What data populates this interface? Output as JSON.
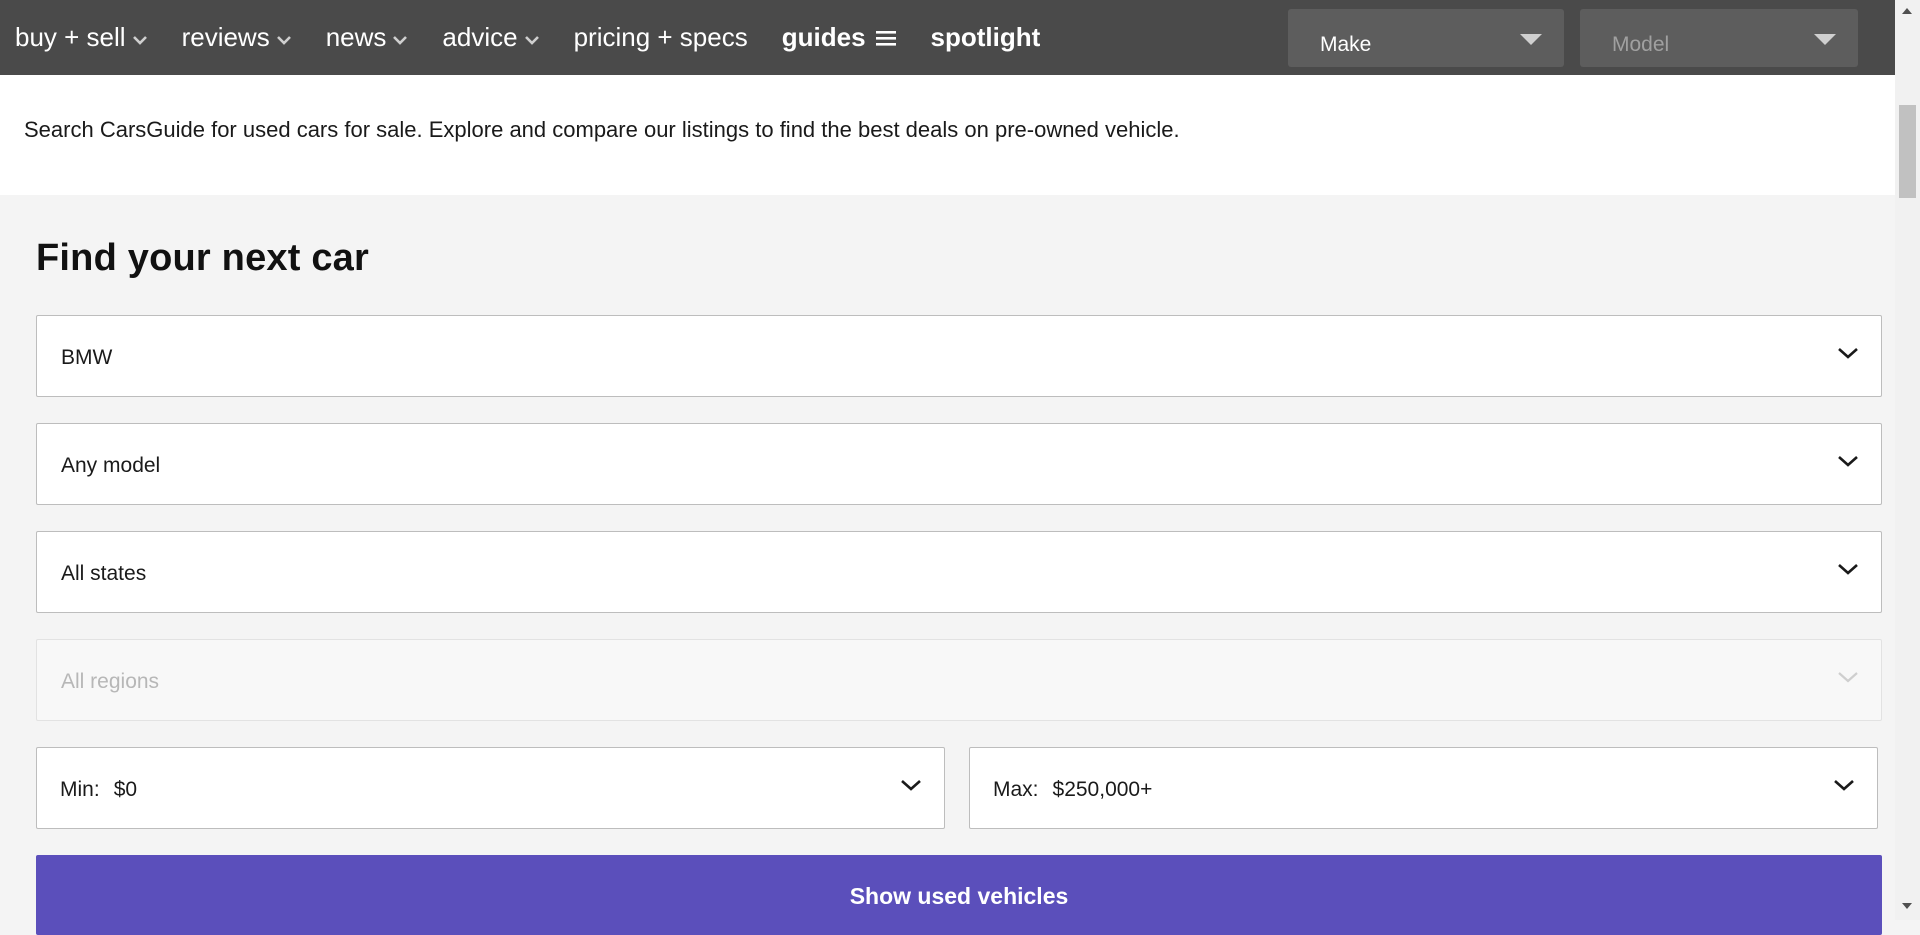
{
  "nav": {
    "items": [
      {
        "label": "buy + sell",
        "dropdown": true
      },
      {
        "label": "reviews",
        "dropdown": true
      },
      {
        "label": "news",
        "dropdown": true
      },
      {
        "label": "advice",
        "dropdown": true
      },
      {
        "label": "pricing + specs",
        "dropdown": false
      },
      {
        "label": "guides",
        "icon": "menu-lines-icon"
      },
      {
        "label": "spotlight"
      }
    ],
    "make_select": {
      "value": "Make"
    },
    "model_select": {
      "value": "Model"
    },
    "colors": {
      "bar": "#4a4a4a",
      "select_bg": "#5d5d5d"
    }
  },
  "intro": {
    "text": "Search CarsGuide for used cars for sale. Explore and compare our listings to find the best deals on pre-owned vehicle."
  },
  "search": {
    "heading": "Find your next car",
    "make": {
      "value": "BMW"
    },
    "model": {
      "value": "Any model"
    },
    "state": {
      "value": "All states"
    },
    "region": {
      "value": "All regions",
      "disabled": true
    },
    "price_min": {
      "prefix": "Min:",
      "value": "$0"
    },
    "price_max": {
      "prefix": "Max:",
      "value": "$250,000+"
    },
    "submit_label": "Show used vehicles",
    "colors": {
      "accent": "#5b4fbb"
    }
  }
}
